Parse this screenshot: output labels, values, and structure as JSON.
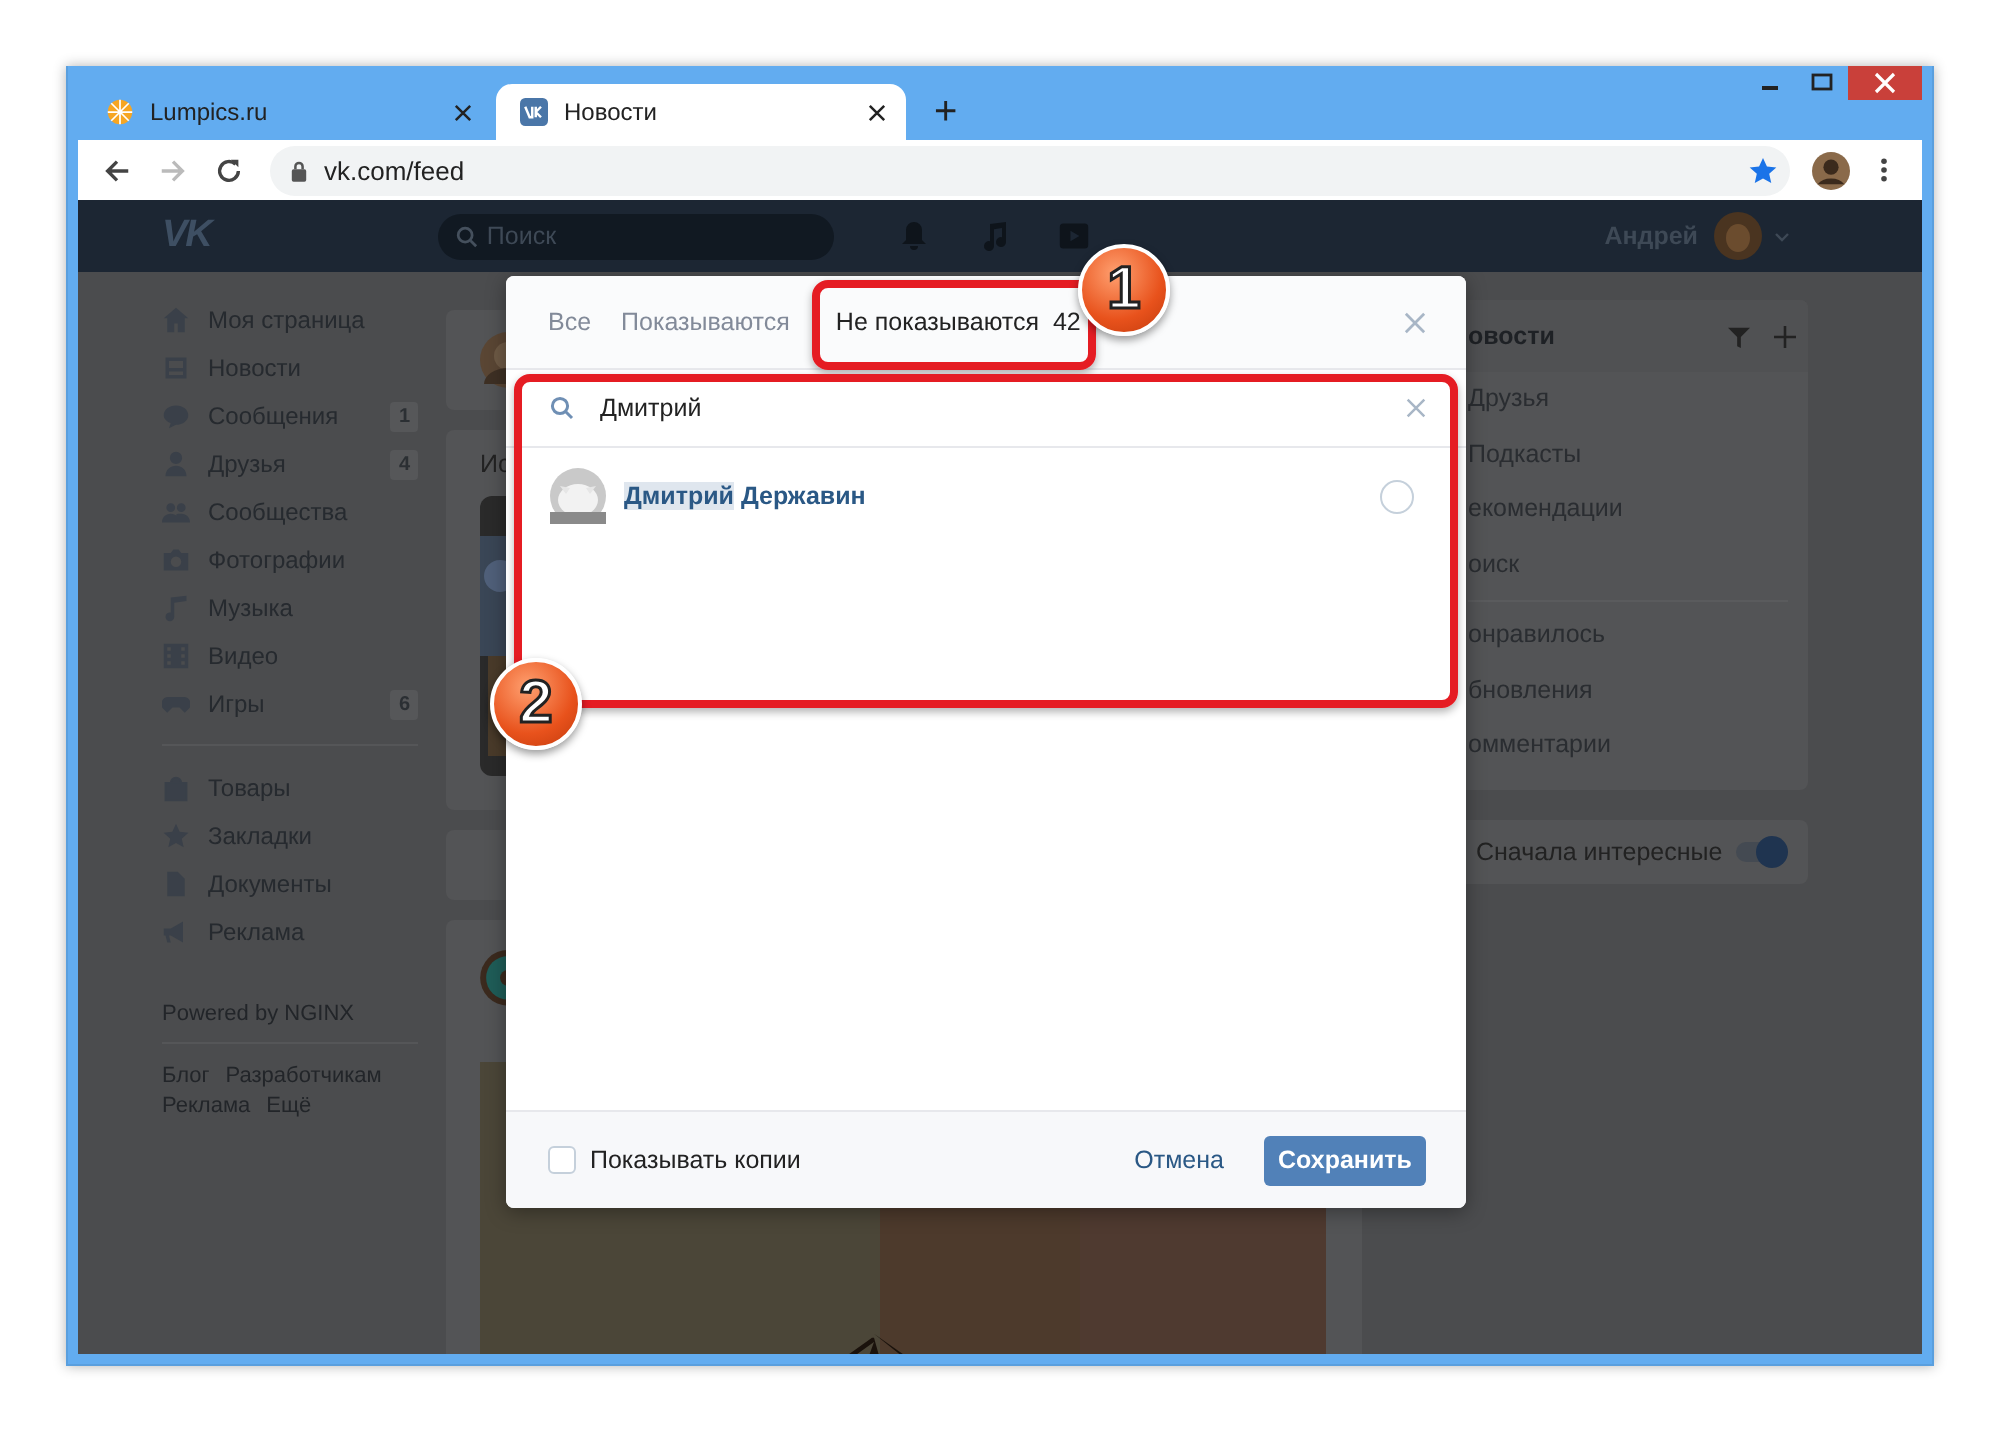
{
  "browser": {
    "tabs": [
      {
        "title": "Lumpics.ru",
        "selected": false
      },
      {
        "title": "Новости",
        "selected": true
      }
    ],
    "new_tab": "+",
    "url": "vk.com/feed"
  },
  "header": {
    "logo": "VK",
    "search_placeholder": "Поиск",
    "user_name": "Андрей"
  },
  "sidebar": {
    "items": [
      {
        "label": "Моя страница"
      },
      {
        "label": "Новости"
      },
      {
        "label": "Сообщения",
        "badge": "1"
      },
      {
        "label": "Друзья",
        "badge": "4"
      },
      {
        "label": "Сообщества"
      },
      {
        "label": "Фотографии"
      },
      {
        "label": "Музыка"
      },
      {
        "label": "Видео"
      },
      {
        "label": "Игры",
        "badge": "6"
      }
    ],
    "items2": [
      {
        "label": "Товары"
      },
      {
        "label": "Закладки"
      },
      {
        "label": "Документы"
      },
      {
        "label": "Реклама"
      }
    ],
    "powered": "Powered by NGINX",
    "links": [
      "Блог",
      "Разработчикам",
      "Реклама",
      "Ещё"
    ]
  },
  "feed": {
    "heading": "Ис"
  },
  "right_panel": {
    "title": "овости",
    "items": [
      "Друзья",
      "Подкасты",
      "екомендации",
      "оиск"
    ],
    "items2": [
      "онравилось",
      "бновления",
      "омментарии"
    ],
    "toggle": {
      "label": "Сначала интересные",
      "on": true
    }
  },
  "dialog": {
    "tabs": [
      {
        "label": "Все",
        "selected": false
      },
      {
        "label": "Показываются",
        "selected": false
      },
      {
        "label": "Не показываются",
        "count": "42",
        "selected": true
      }
    ],
    "search": {
      "value": "Дмитрий"
    },
    "results": [
      {
        "name_parts": [
          {
            "text": "Дмитрий",
            "match": true
          },
          {
            "text": "Державин",
            "match": false
          }
        ],
        "selected": false
      }
    ],
    "show_copies": {
      "label": "Показывать копии",
      "checked": false
    },
    "cancel": "Отмена",
    "save": "Сохранить"
  },
  "annotations": [
    {
      "number": "1"
    },
    {
      "number": "2"
    }
  ]
}
